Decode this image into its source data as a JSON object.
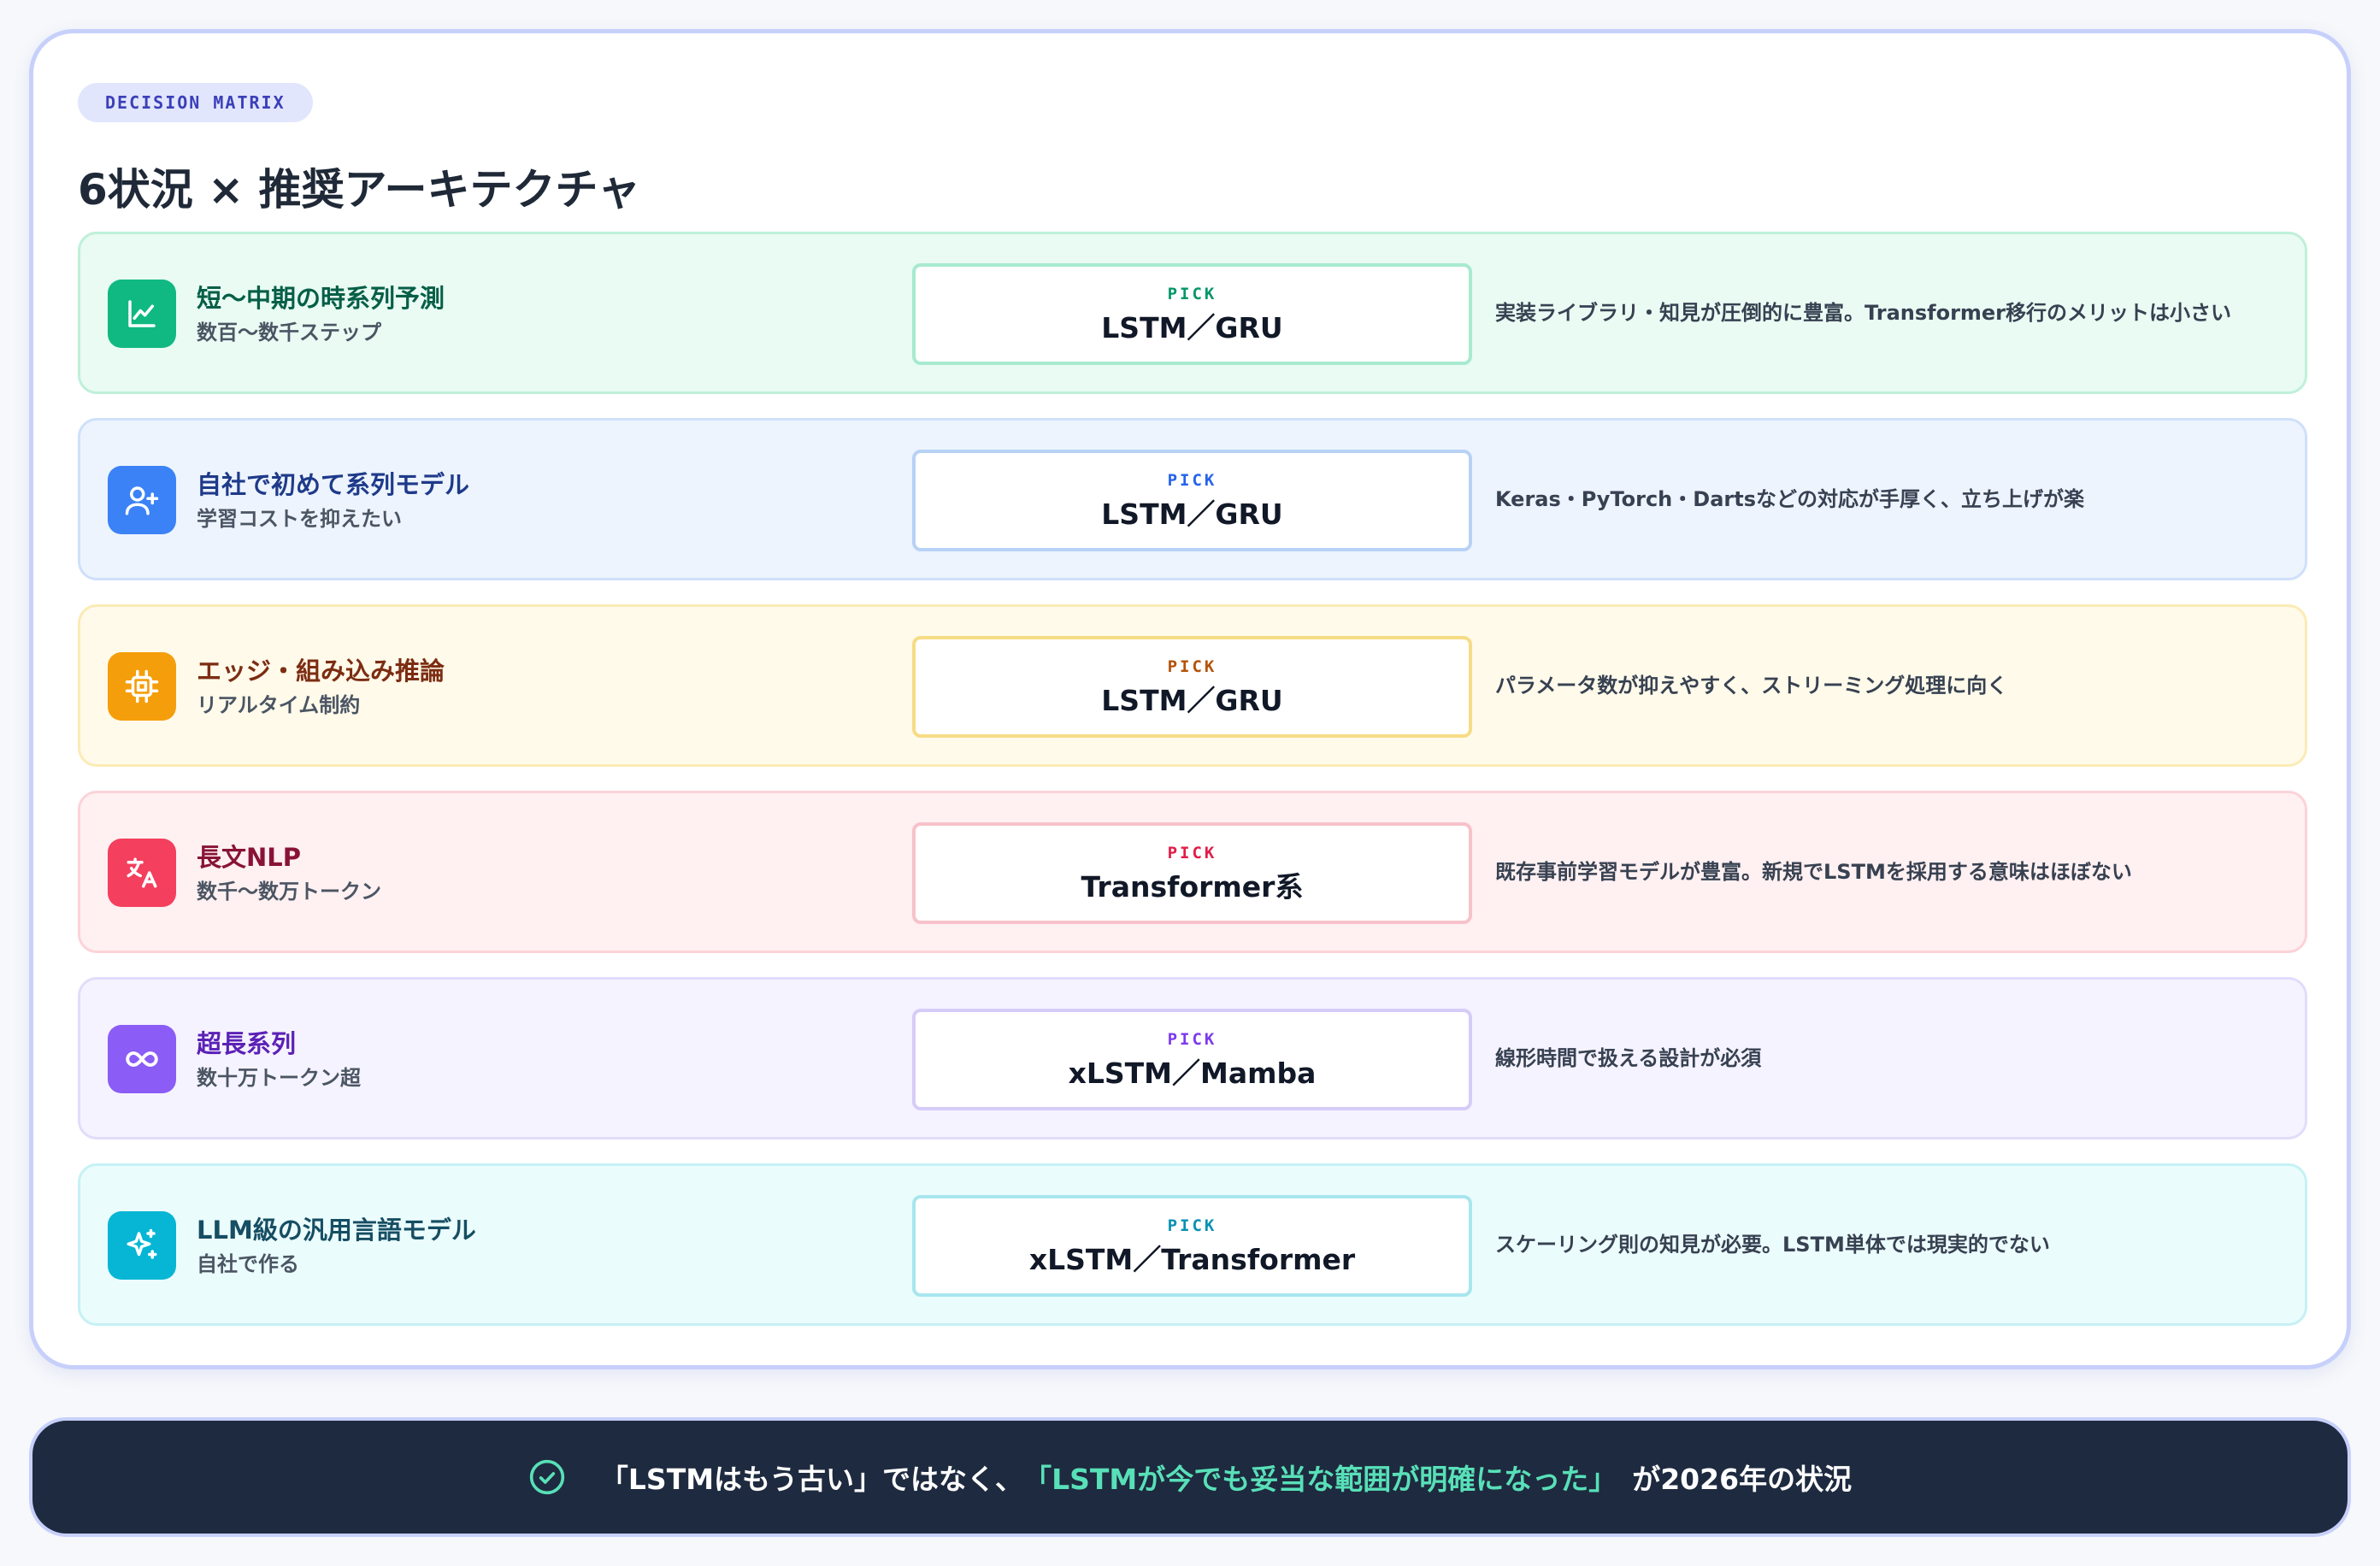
{
  "badge": "DECISION MATRIX",
  "title": "6状況 × 推奨アーキテクチャ",
  "pick_label": "PICK",
  "rows": [
    {
      "title": "短〜中期の時系列予測",
      "subtitle": "数百〜数千ステップ",
      "pick": "LSTM／GRU",
      "reason": "実装ライブラリ・知見が圧倒的に豊富。Transformer移行のメリットは小さい",
      "icon": "chart-line-icon",
      "colors": {
        "bg": "#e9fbf3",
        "border": "#bff0d9",
        "icon": "#10b981",
        "title": "#065f46",
        "pick_border": "#a7ead0",
        "pick_label": "#059669"
      }
    },
    {
      "title": "自社で初めて系列モデル",
      "subtitle": "学習コストを抑えたい",
      "pick": "LSTM／GRU",
      "reason": "Keras・PyTorch・Dartsなどの対応が手厚く、立ち上げが楽",
      "icon": "user-plus-icon",
      "colors": {
        "bg": "#edf4fe",
        "border": "#cfe0fa",
        "icon": "#3b82f6",
        "title": "#1e3a8a",
        "pick_border": "#b8d2f6",
        "pick_label": "#2563eb"
      }
    },
    {
      "title": "エッジ・組み込み推論",
      "subtitle": "リアルタイム制約",
      "pick": "LSTM／GRU",
      "reason": "パラメータ数が抑えやすく、ストリーミング処理に向く",
      "icon": "cpu-chip-icon",
      "colors": {
        "bg": "#fffaea",
        "border": "#fbebb5",
        "icon": "#f59e0b",
        "title": "#7c2d12",
        "pick_border": "#f7dc86",
        "pick_label": "#b45309"
      }
    },
    {
      "title": "長文NLP",
      "subtitle": "数千〜数万トークン",
      "pick": "Transformer系",
      "reason": "既存事前学習モデルが豊富。新規でLSTMを採用する意味はほぼない",
      "icon": "translate-icon",
      "colors": {
        "bg": "#fff0f1",
        "border": "#fbd3d8",
        "icon": "#f43f5e",
        "title": "#881337",
        "pick_border": "#f7c2ca",
        "pick_label": "#e11d48"
      }
    },
    {
      "title": "超長系列",
      "subtitle": "数十万トークン超",
      "pick": "xLSTM／Mamba",
      "reason": "線形時間で扱える設計が必須",
      "icon": "infinity-icon",
      "colors": {
        "bg": "#f5f3ff",
        "border": "#e2dcfb",
        "icon": "#8b5cf6",
        "title": "#5b21b6",
        "pick_border": "#d6ccf8",
        "pick_label": "#7c3aed"
      }
    },
    {
      "title": "LLM級の汎用言語モデル",
      "subtitle": "自社で作る",
      "pick": "xLSTM／Transformer",
      "reason": "スケーリング則の知見が必要。LSTM単体では現実的でない",
      "icon": "sparkles-icon",
      "colors": {
        "bg": "#ebfcfd",
        "border": "#c6f1f5",
        "icon": "#06b6d4",
        "title": "#164e63",
        "pick_border": "#a8e6ee",
        "pick_label": "#0891b2"
      }
    }
  ],
  "footer": {
    "icon": "check-circle-icon",
    "pre": "「LSTMはもう古い」ではなく、",
    "highlight": "「LSTMが今でも妥当な範囲が明確になった」",
    "post": "が2026年の状況",
    "highlight_color": "#58e0b8"
  }
}
